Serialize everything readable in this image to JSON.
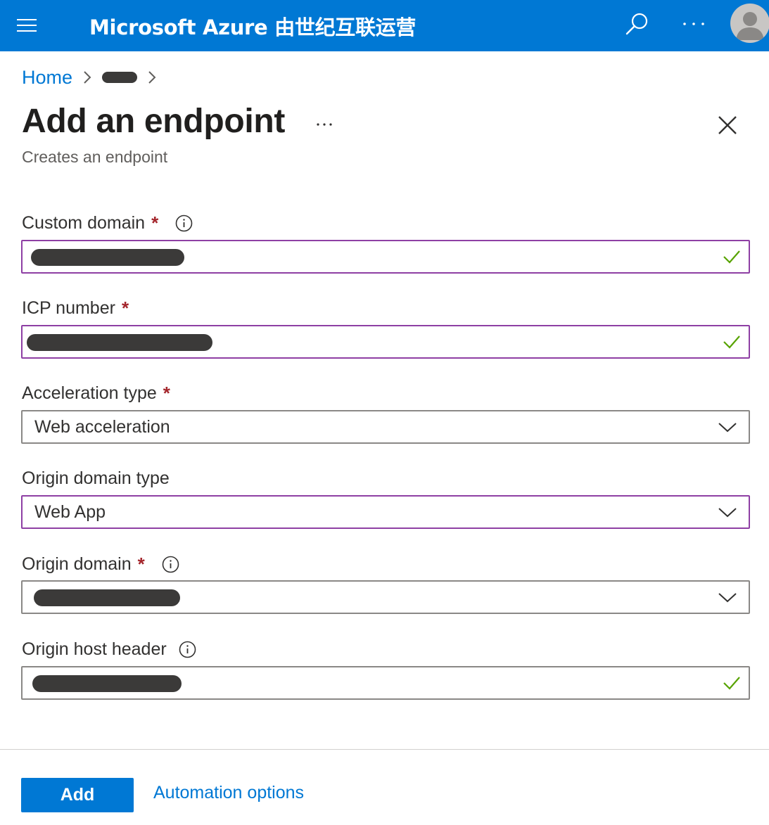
{
  "header": {
    "brand": "Microsoft Azure 由世纪互联运营",
    "icons": [
      "hamburger-menu-icon",
      "search-icon",
      "more-icon",
      "avatar"
    ]
  },
  "breadcrumb": {
    "home": "Home",
    "current": "[redacted]"
  },
  "panel": {
    "title": "Add an endpoint",
    "subtitle": "Creates an endpoint"
  },
  "form": {
    "custom_domain": {
      "label": "Custom domain",
      "required": "*",
      "value": "[redacted]",
      "valid": true
    },
    "icp_number": {
      "label": "ICP number",
      "required": "*",
      "value": "[redacted]",
      "valid": true
    },
    "acceleration_type": {
      "label": "Acceleration type",
      "required": "*",
      "value": "Web acceleration"
    },
    "origin_domain_type": {
      "label": "Origin domain type",
      "value": "Web App"
    },
    "origin_domain": {
      "label": "Origin domain",
      "required": "*",
      "value": "[redacted]"
    },
    "origin_host_header": {
      "label": "Origin host header",
      "value": "[redacted]",
      "valid": true
    }
  },
  "footer": {
    "add_label": "Add",
    "automation_label": "Automation options"
  },
  "colors": {
    "brand": "#0078d4",
    "active_border": "#8e3fa4",
    "required": "#a4262c",
    "valid": "#57a300"
  }
}
